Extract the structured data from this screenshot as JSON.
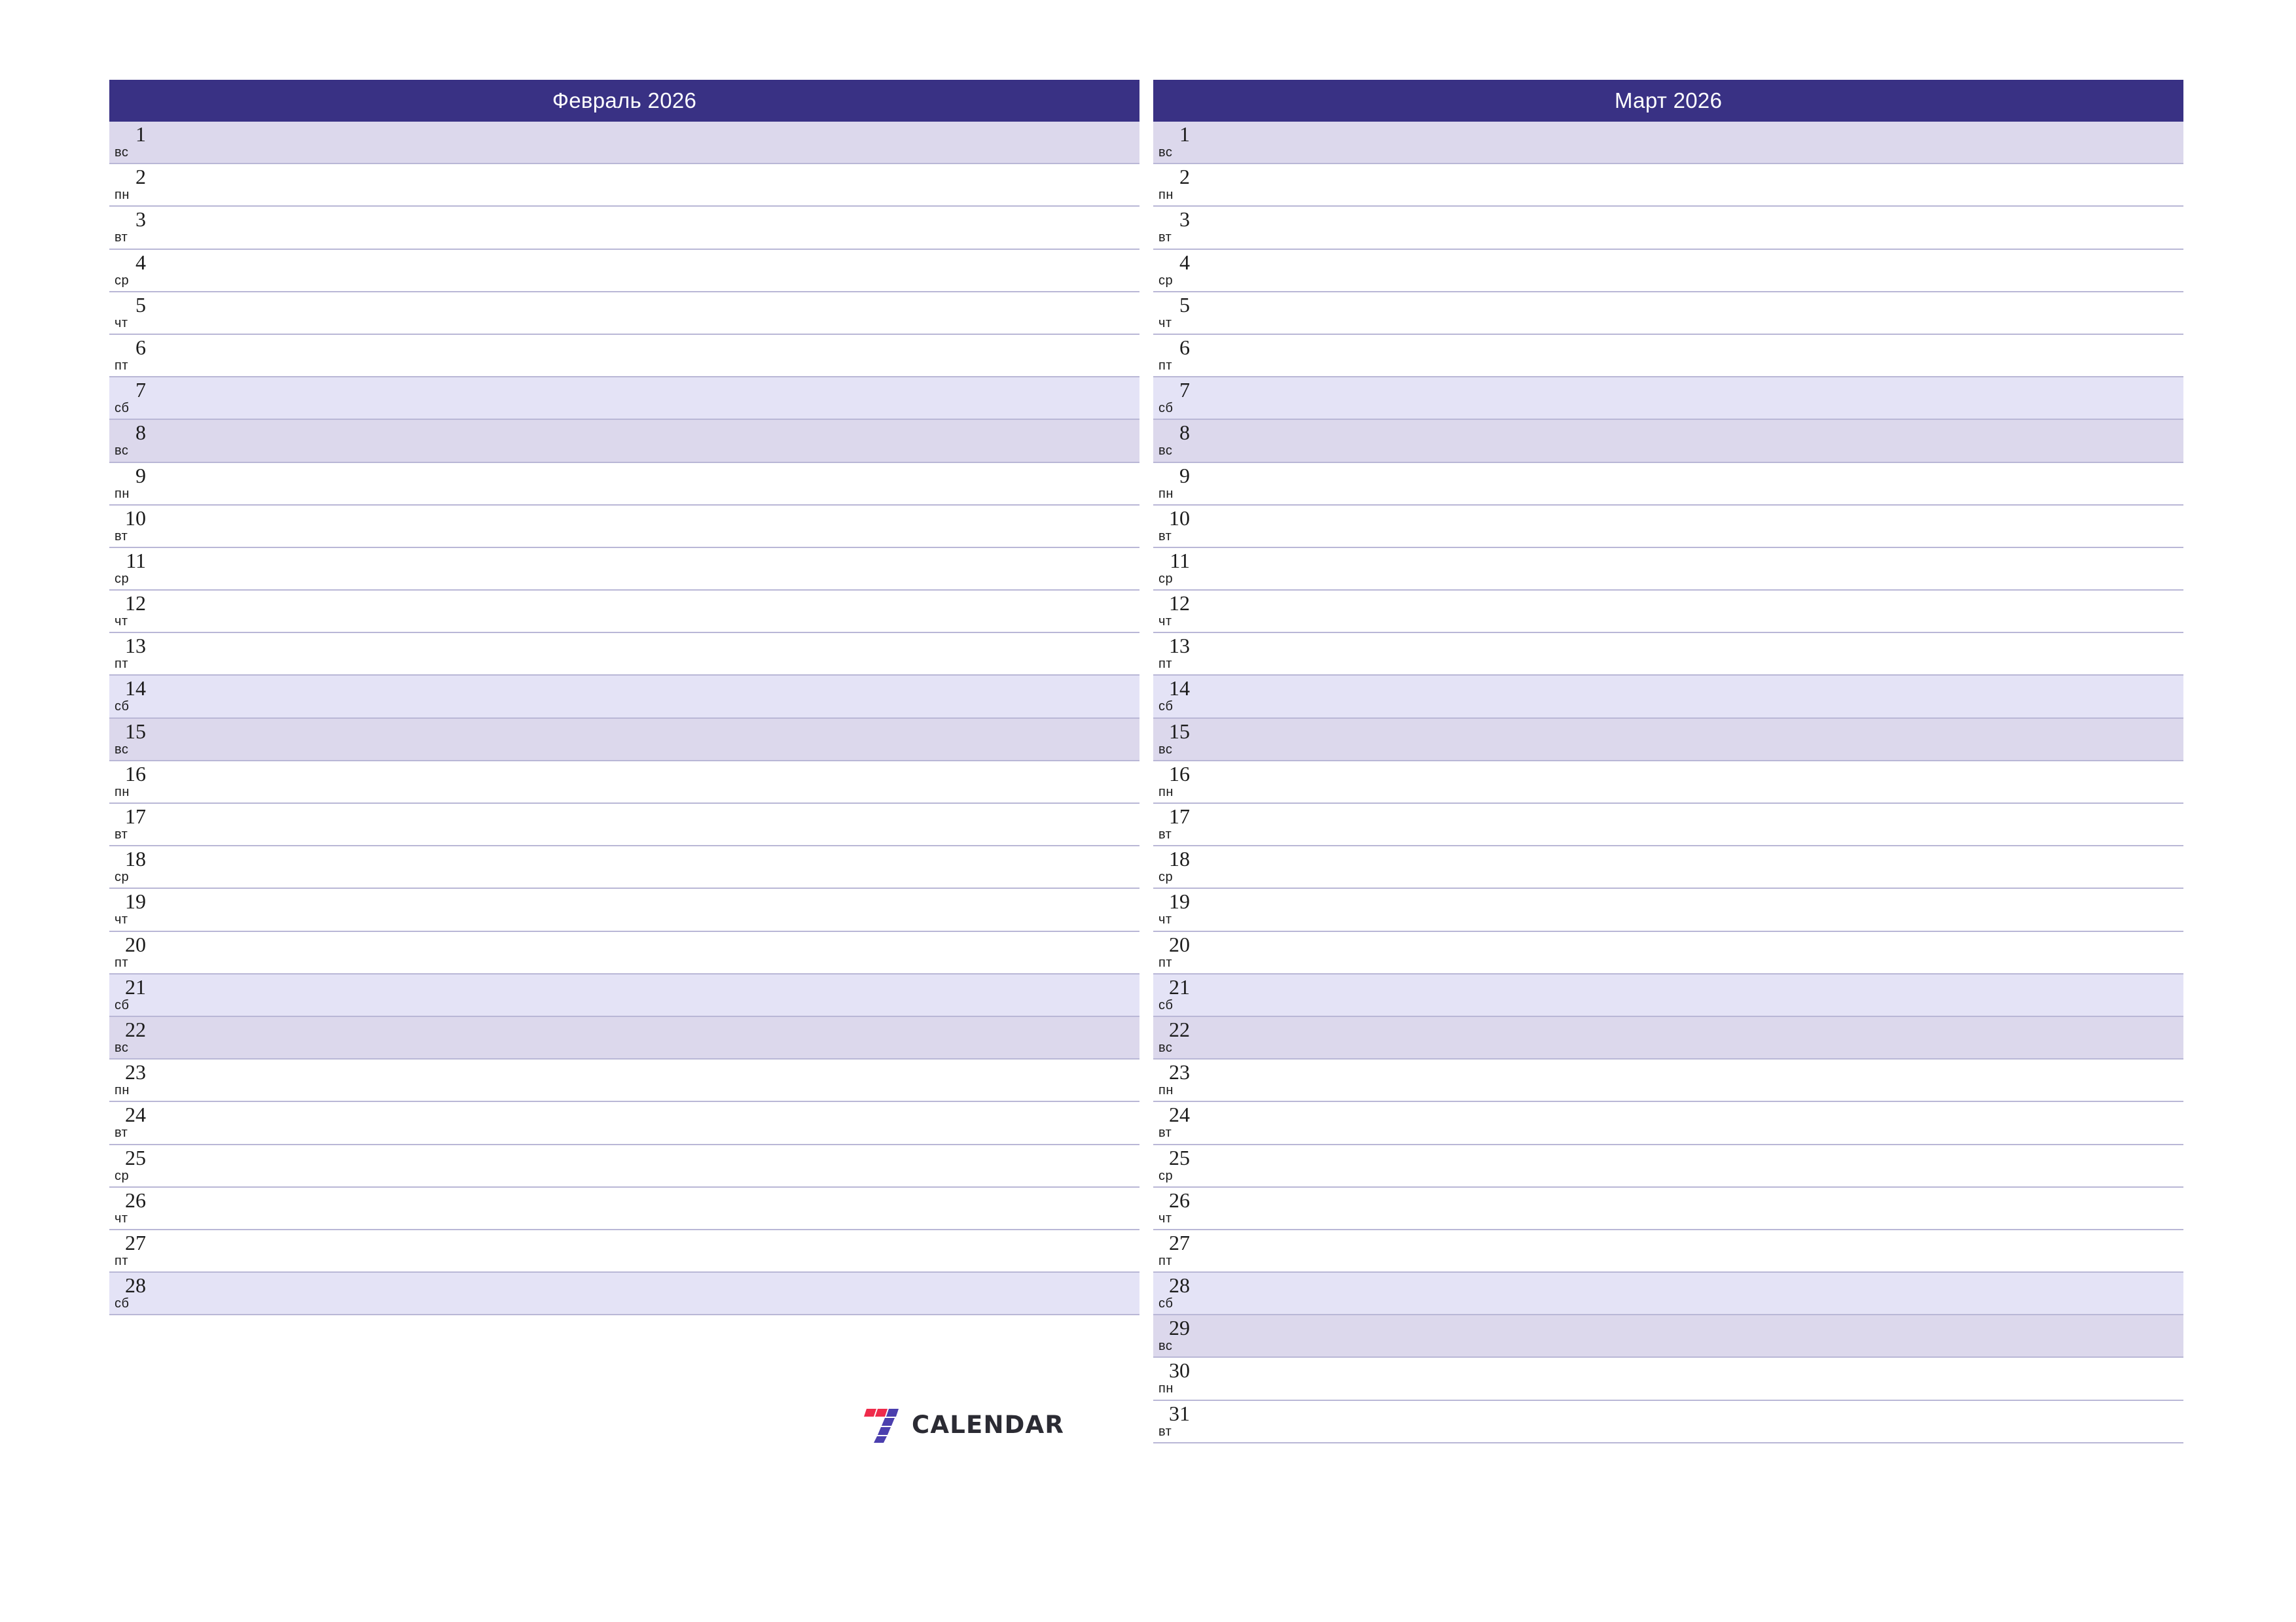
{
  "document": {
    "type": "monthly-planner",
    "language": "ru",
    "logo": {
      "mark_name": "seven-logo-mark",
      "text": "CALENDAR",
      "accent_red": "#ef2b4b",
      "accent_purple": "#4b3fae"
    },
    "colors": {
      "header_bg": "#393184",
      "header_text": "#ffffff",
      "saturday_bg": "#e4e3f6",
      "sunday_bg": "#dcd8ec",
      "rule_line": "#b9b7d6",
      "page_bg": "#ffffff",
      "text": "#1b1b1b"
    }
  },
  "months": [
    {
      "title": "Февраль 2026",
      "days": [
        {
          "num": "1",
          "wd": "вс",
          "kind": "sun"
        },
        {
          "num": "2",
          "wd": "пн",
          "kind": "weekday"
        },
        {
          "num": "3",
          "wd": "вт",
          "kind": "weekday"
        },
        {
          "num": "4",
          "wd": "ср",
          "kind": "weekday"
        },
        {
          "num": "5",
          "wd": "чт",
          "kind": "weekday"
        },
        {
          "num": "6",
          "wd": "пт",
          "kind": "weekday"
        },
        {
          "num": "7",
          "wd": "сб",
          "kind": "sat"
        },
        {
          "num": "8",
          "wd": "вс",
          "kind": "sun"
        },
        {
          "num": "9",
          "wd": "пн",
          "kind": "weekday"
        },
        {
          "num": "10",
          "wd": "вт",
          "kind": "weekday"
        },
        {
          "num": "11",
          "wd": "ср",
          "kind": "weekday"
        },
        {
          "num": "12",
          "wd": "чт",
          "kind": "weekday"
        },
        {
          "num": "13",
          "wd": "пт",
          "kind": "weekday"
        },
        {
          "num": "14",
          "wd": "сб",
          "kind": "sat"
        },
        {
          "num": "15",
          "wd": "вс",
          "kind": "sun"
        },
        {
          "num": "16",
          "wd": "пн",
          "kind": "weekday"
        },
        {
          "num": "17",
          "wd": "вт",
          "kind": "weekday"
        },
        {
          "num": "18",
          "wd": "ср",
          "kind": "weekday"
        },
        {
          "num": "19",
          "wd": "чт",
          "kind": "weekday"
        },
        {
          "num": "20",
          "wd": "пт",
          "kind": "weekday"
        },
        {
          "num": "21",
          "wd": "сб",
          "kind": "sat"
        },
        {
          "num": "22",
          "wd": "вс",
          "kind": "sun"
        },
        {
          "num": "23",
          "wd": "пн",
          "kind": "weekday"
        },
        {
          "num": "24",
          "wd": "вт",
          "kind": "weekday"
        },
        {
          "num": "25",
          "wd": "ср",
          "kind": "weekday"
        },
        {
          "num": "26",
          "wd": "чт",
          "kind": "weekday"
        },
        {
          "num": "27",
          "wd": "пт",
          "kind": "weekday"
        },
        {
          "num": "28",
          "wd": "сб",
          "kind": "sat"
        }
      ]
    },
    {
      "title": "Март 2026",
      "days": [
        {
          "num": "1",
          "wd": "вс",
          "kind": "sun"
        },
        {
          "num": "2",
          "wd": "пн",
          "kind": "weekday"
        },
        {
          "num": "3",
          "wd": "вт",
          "kind": "weekday"
        },
        {
          "num": "4",
          "wd": "ср",
          "kind": "weekday"
        },
        {
          "num": "5",
          "wd": "чт",
          "kind": "weekday"
        },
        {
          "num": "6",
          "wd": "пт",
          "kind": "weekday"
        },
        {
          "num": "7",
          "wd": "сб",
          "kind": "sat"
        },
        {
          "num": "8",
          "wd": "вс",
          "kind": "sun"
        },
        {
          "num": "9",
          "wd": "пн",
          "kind": "weekday"
        },
        {
          "num": "10",
          "wd": "вт",
          "kind": "weekday"
        },
        {
          "num": "11",
          "wd": "ср",
          "kind": "weekday"
        },
        {
          "num": "12",
          "wd": "чт",
          "kind": "weekday"
        },
        {
          "num": "13",
          "wd": "пт",
          "kind": "weekday"
        },
        {
          "num": "14",
          "wd": "сб",
          "kind": "sat"
        },
        {
          "num": "15",
          "wd": "вс",
          "kind": "sun"
        },
        {
          "num": "16",
          "wd": "пн",
          "kind": "weekday"
        },
        {
          "num": "17",
          "wd": "вт",
          "kind": "weekday"
        },
        {
          "num": "18",
          "wd": "ср",
          "kind": "weekday"
        },
        {
          "num": "19",
          "wd": "чт",
          "kind": "weekday"
        },
        {
          "num": "20",
          "wd": "пт",
          "kind": "weekday"
        },
        {
          "num": "21",
          "wd": "сб",
          "kind": "sat"
        },
        {
          "num": "22",
          "wd": "вс",
          "kind": "sun"
        },
        {
          "num": "23",
          "wd": "пн",
          "kind": "weekday"
        },
        {
          "num": "24",
          "wd": "вт",
          "kind": "weekday"
        },
        {
          "num": "25",
          "wd": "ср",
          "kind": "weekday"
        },
        {
          "num": "26",
          "wd": "чт",
          "kind": "weekday"
        },
        {
          "num": "27",
          "wd": "пт",
          "kind": "weekday"
        },
        {
          "num": "28",
          "wd": "сб",
          "kind": "sat"
        },
        {
          "num": "29",
          "wd": "вс",
          "kind": "sun"
        },
        {
          "num": "30",
          "wd": "пн",
          "kind": "weekday"
        },
        {
          "num": "31",
          "wd": "вт",
          "kind": "weekday"
        }
      ]
    }
  ]
}
